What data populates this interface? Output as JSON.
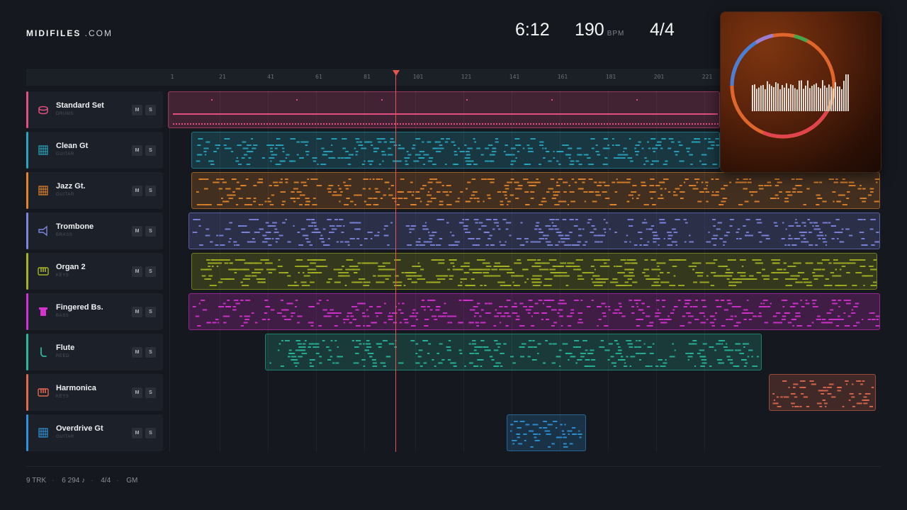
{
  "brand": {
    "bold": "MIDIFILES",
    "rest": " .COM"
  },
  "transport": {
    "time": "6:12",
    "bpm": "190",
    "bpm_unit": "BPM",
    "time_signature": "4/4"
  },
  "ruler": {
    "ticks": [
      "1",
      "21",
      "41",
      "61",
      "81",
      "101",
      "121",
      "141",
      "161",
      "181",
      "201",
      "221"
    ]
  },
  "tracks": [
    {
      "name": "Standard Set",
      "category": "DRUMS",
      "color": "#e24f7e",
      "icon": "drum-icon"
    },
    {
      "name": "Clean Gt",
      "category": "GUITAR",
      "color": "#27a7c0",
      "icon": "guitar-icon"
    },
    {
      "name": "Jazz Gt.",
      "category": "GUITAR",
      "color": "#e2852a",
      "icon": "guitar-icon"
    },
    {
      "name": "Trombone",
      "category": "BRASS",
      "color": "#7d86df",
      "icon": "trombone-icon"
    },
    {
      "name": "Organ 2",
      "category": "KEYS",
      "color": "#a5b320",
      "icon": "keys-icon"
    },
    {
      "name": "Fingered Bs.",
      "category": "BASS",
      "color": "#d632d1",
      "icon": "bass-icon"
    },
    {
      "name": "Flute",
      "category": "REED",
      "color": "#27b89b",
      "icon": "flute-icon"
    },
    {
      "name": "Harmonica",
      "category": "KEYS",
      "color": "#e0684e",
      "icon": "keys-icon"
    },
    {
      "name": "Overdrive Gt",
      "category": "GUITAR",
      "color": "#2e93d8",
      "icon": "guitar-icon"
    }
  ],
  "buttons": {
    "mute": "M",
    "solo": "S"
  },
  "footer": {
    "tracks": "9 TRK",
    "notes": "6 294 ♪",
    "signature": "4/4",
    "standard": "GM"
  }
}
